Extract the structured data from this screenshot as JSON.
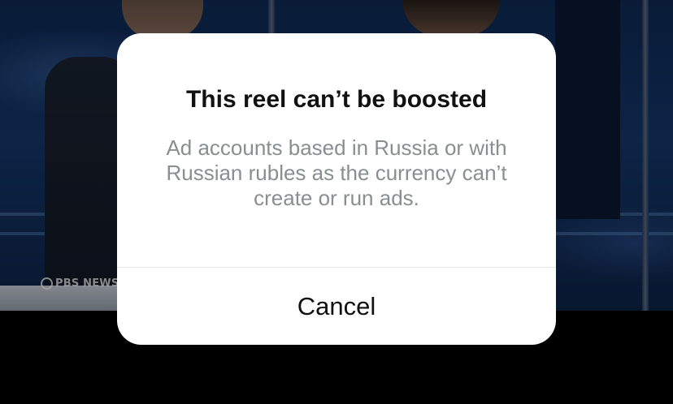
{
  "background": {
    "watermark": "PBS NEWS"
  },
  "dialog": {
    "title": "This reel can’t be boosted",
    "message": "Ad accounts based in Russia or with Russian rubles as the currency can’t create or run ads.",
    "cancel_label": "Cancel"
  },
  "colors": {
    "dialog_background": "#ffffff",
    "title_text": "#111111",
    "message_text": "#8a8d92",
    "divider": "#e3e3e6",
    "screen_background": "#000000"
  }
}
